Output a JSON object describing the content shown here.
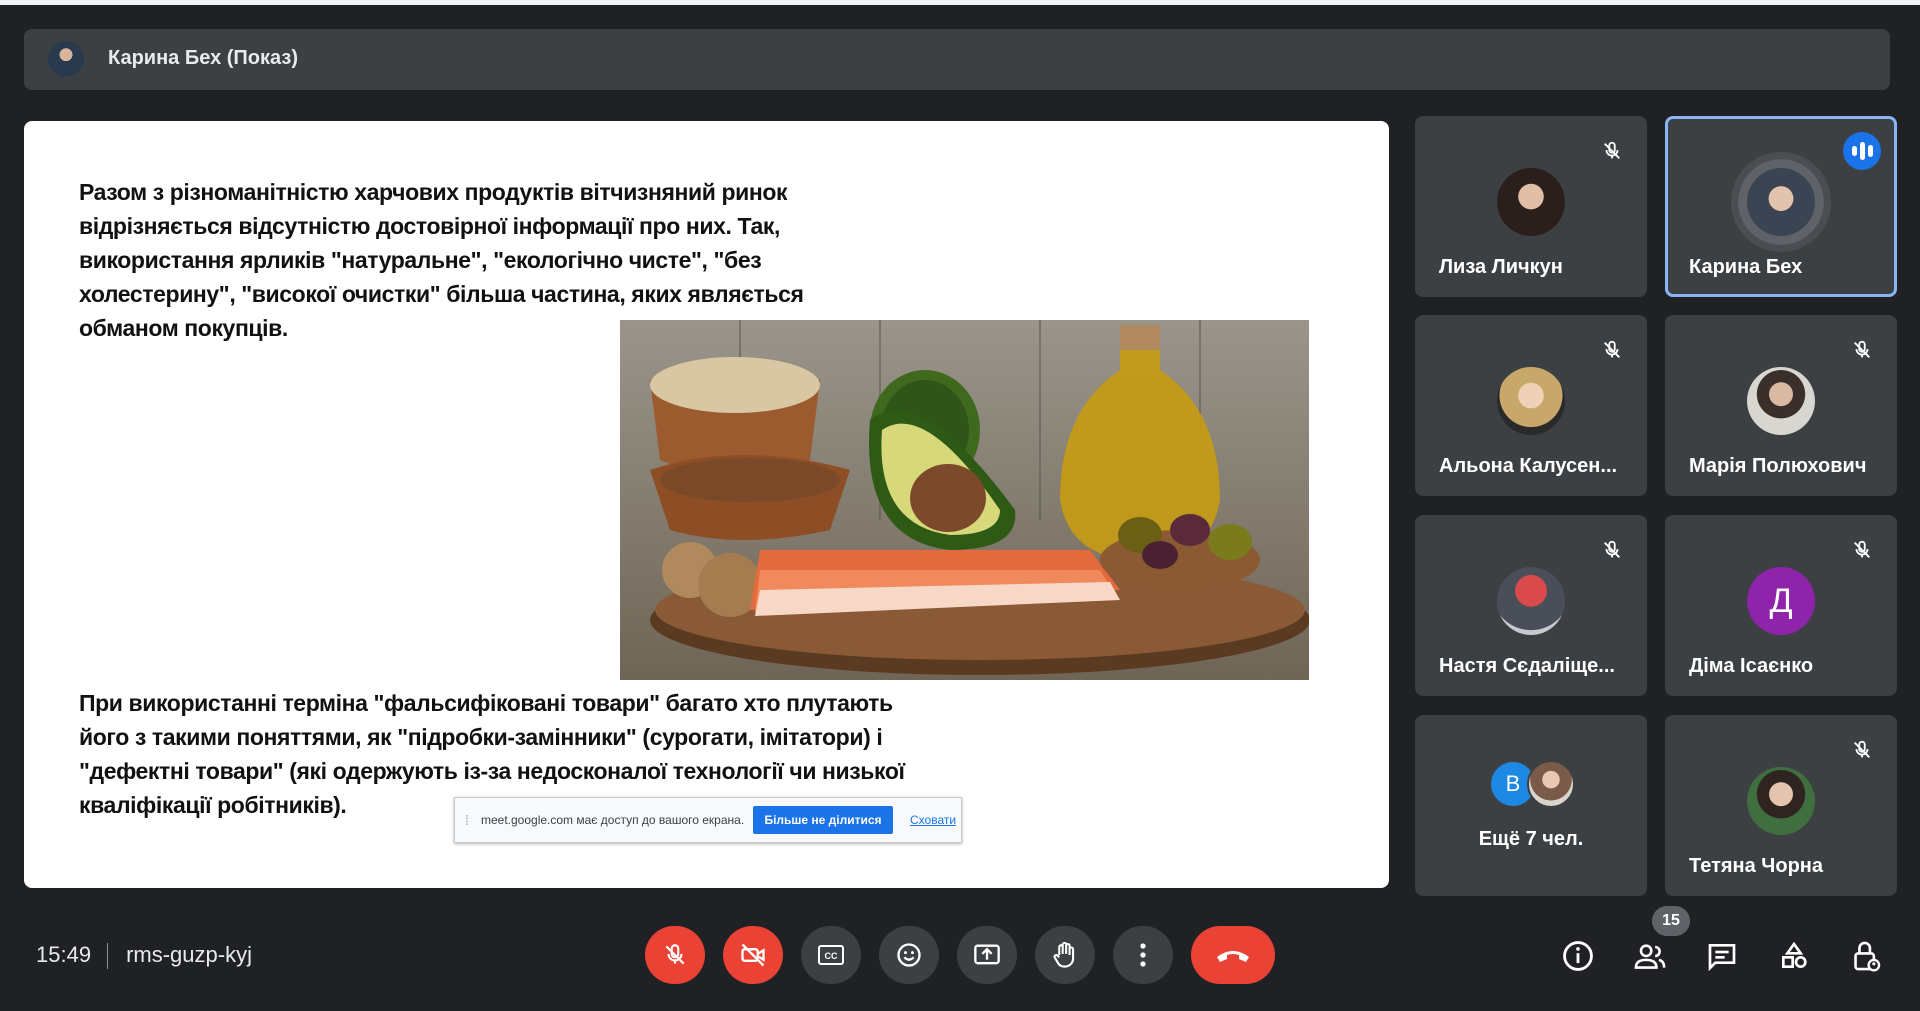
{
  "presenter": {
    "name": "Карина Бех (Показ)"
  },
  "slide": {
    "paragraph1": "Разом з різноманітністю харчових продуктів вітчизняний ринок відрізняється відсутністю достовірної інформації про них. Так, використання ярликів \"натуральне\", \"екологічно чисте\", \"без холестерину\", \"високої очистки\" більша частина, яких являється обманом покупців.",
    "paragraph2": "При використанні терміна \"фальсифіковані товари\" багато хто плутають його з такими поняттями, як \"підробки-замінники\" (сурогати, імітатори) і \"дефектні товари\" (які одержують із-за недосконалої технології чи низької кваліфікації робітників)."
  },
  "share_banner": {
    "message": "meet.google.com має доступ до вашого екрана.",
    "stop_label": "Більше не ділитися",
    "hide_label": "Сховати"
  },
  "participants": [
    {
      "name": "Лиза Личкун",
      "muted": true
    },
    {
      "name": "Карина Бех",
      "muted": false,
      "speaking": true
    },
    {
      "name": "Альона Калусен...",
      "muted": true
    },
    {
      "name": "Марія Полюхович",
      "muted": true
    },
    {
      "name": "Настя Сєдаліще...",
      "muted": true
    },
    {
      "name": "Діма Ісаєнко",
      "muted": true,
      "initial": "Д"
    },
    {
      "name": "Ещё 7 чел.",
      "initial": "B"
    },
    {
      "name": "Тетяна Чорна",
      "muted": true
    }
  ],
  "footer": {
    "time": "15:49",
    "meeting_code": "rms-guzp-kyj",
    "participant_count": "15"
  },
  "colors": {
    "background": "#202124",
    "tile": "#3c4043",
    "danger": "#ea4335",
    "accent": "#1a73e8",
    "active_border": "#8ab4f8"
  }
}
